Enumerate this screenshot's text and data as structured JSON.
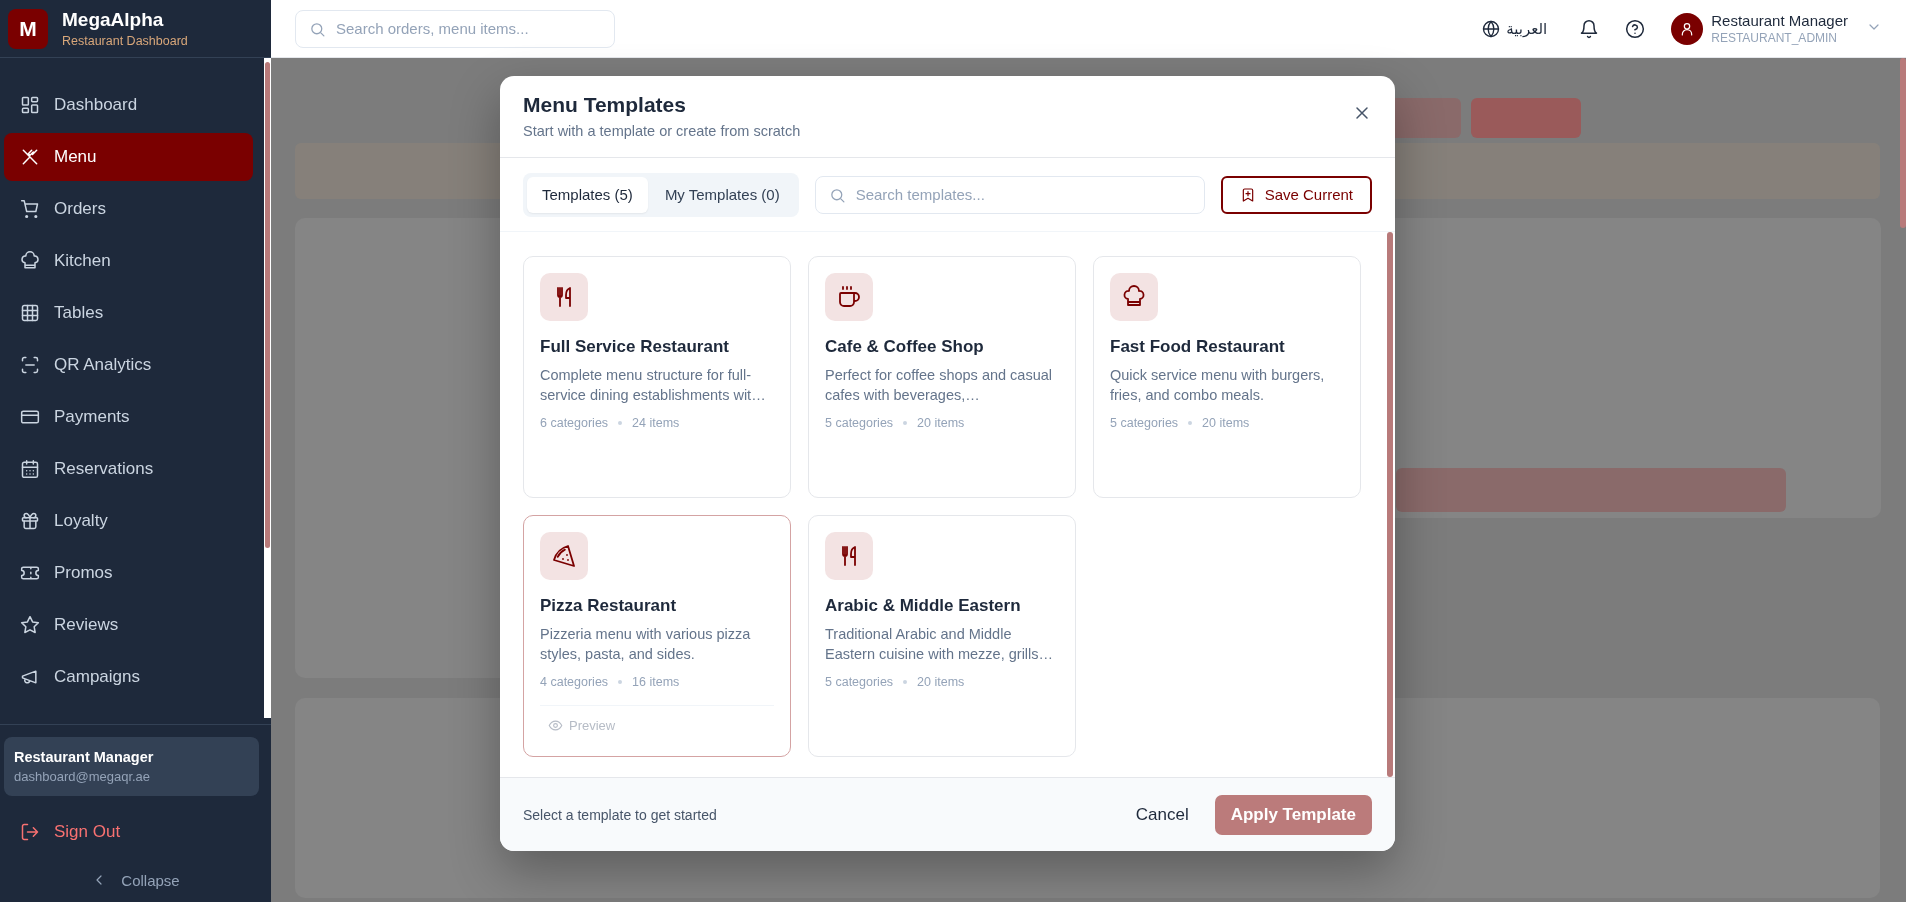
{
  "sidebar": {
    "brand": {
      "logo_letter": "M",
      "name": "MegaAlpha",
      "subtitle": "Restaurant Dashboard"
    },
    "items": [
      {
        "label": "Dashboard",
        "selected": false
      },
      {
        "label": "Menu",
        "selected": true
      },
      {
        "label": "Orders",
        "selected": false
      },
      {
        "label": "Kitchen",
        "selected": false
      },
      {
        "label": "Tables",
        "selected": false
      },
      {
        "label": "QR Analytics",
        "selected": false
      },
      {
        "label": "Payments",
        "selected": false
      },
      {
        "label": "Reservations",
        "selected": false
      },
      {
        "label": "Loyalty",
        "selected": false
      },
      {
        "label": "Promos",
        "selected": false
      },
      {
        "label": "Reviews",
        "selected": false
      },
      {
        "label": "Campaigns",
        "selected": false
      }
    ],
    "user": {
      "name": "Restaurant Manager",
      "email": "dashboard@megaqr.ae"
    },
    "sign_out": "Sign Out",
    "collapse": "Collapse"
  },
  "topbar": {
    "search": {
      "placeholder": "Search orders, menu items..."
    },
    "language": "العربية",
    "user": {
      "name": "Restaurant Manager",
      "role": "RESTAURANT_ADMIN"
    }
  },
  "modal": {
    "title": "Menu Templates",
    "subtitle": "Start with a template or create from scratch",
    "tabs": [
      {
        "label": "Templates (5)",
        "selected": true
      },
      {
        "label": "My Templates (0)",
        "selected": false
      }
    ],
    "search": {
      "placeholder": "Search templates..."
    },
    "save_button": "Save Current",
    "templates": [
      {
        "title": "Full Service Restaurant",
        "description": "Complete menu structure for full-service dining establishments wit…",
        "categories": "6 categories",
        "items": "24 items",
        "hovered": false
      },
      {
        "title": "Cafe & Coffee Shop",
        "description": "Perfect for coffee shops and casual cafes with beverages,…",
        "categories": "5 categories",
        "items": "20 items",
        "hovered": false
      },
      {
        "title": "Fast Food Restaurant",
        "description": "Quick service menu with burgers, fries, and combo meals.",
        "categories": "5 categories",
        "items": "20 items",
        "hovered": false
      },
      {
        "title": "Pizza Restaurant",
        "description": "Pizzeria menu with various pizza styles, pasta, and sides.",
        "categories": "4 categories",
        "items": "16 items",
        "hovered": true,
        "preview": "Preview"
      },
      {
        "title": "Arabic & Middle Eastern",
        "description": "Traditional Arabic and Middle Eastern cuisine with mezze, grills…",
        "categories": "5 categories",
        "items": "20 items",
        "hovered": false
      }
    ],
    "footer": {
      "hint": "Select a template to get started",
      "cancel": "Cancel",
      "apply": {
        "label": "Apply Template",
        "disabled": true
      }
    }
  }
}
